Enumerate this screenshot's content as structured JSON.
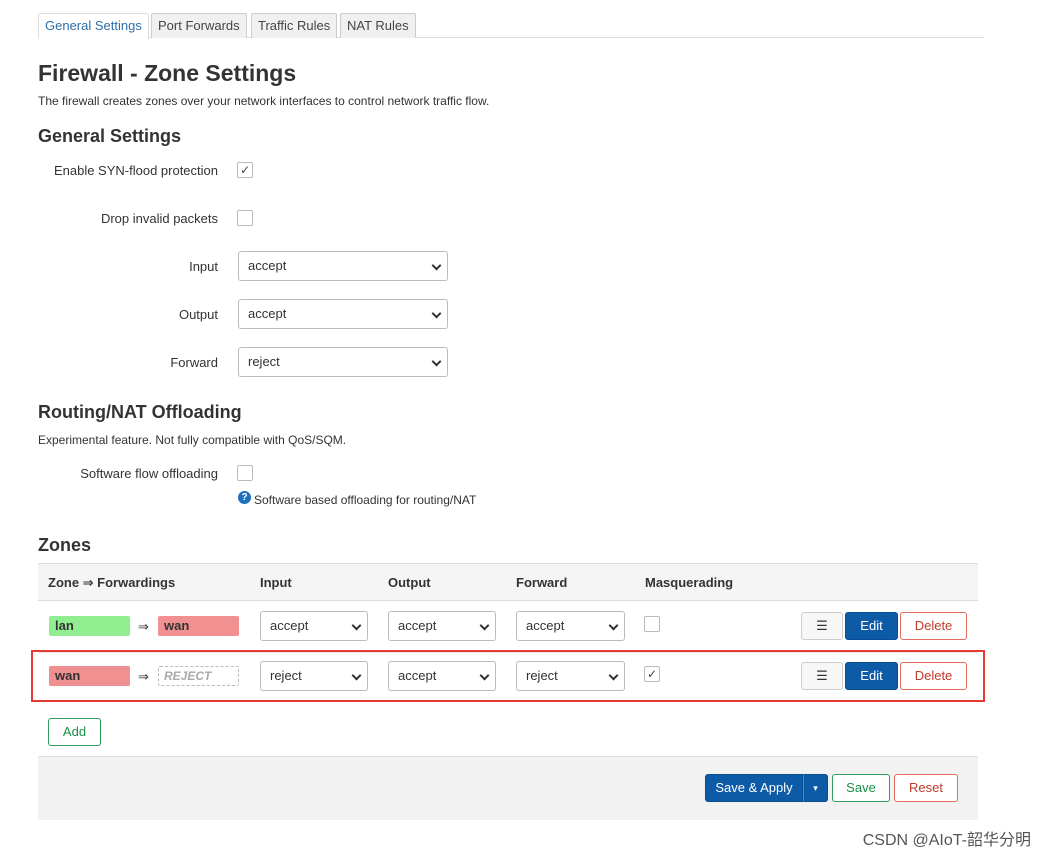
{
  "tabs": [
    {
      "label": "General Settings",
      "active": true
    },
    {
      "label": "Port Forwards"
    },
    {
      "label": "Traffic Rules"
    },
    {
      "label": "NAT Rules"
    }
  ],
  "page": {
    "title": "Firewall - Zone Settings",
    "description": "The firewall creates zones over your network interfaces to control network traffic flow."
  },
  "general": {
    "heading": "General Settings",
    "syn_flood_label": "Enable SYN-flood protection",
    "syn_flood_checked": true,
    "drop_invalid_label": "Drop invalid packets",
    "drop_invalid_checked": false,
    "input_label": "Input",
    "input_value": "accept",
    "output_label": "Output",
    "output_value": "accept",
    "forward_label": "Forward",
    "forward_value": "reject"
  },
  "offloading": {
    "heading": "Routing/NAT Offloading",
    "description": "Experimental feature. Not fully compatible with QoS/SQM.",
    "sw_offload_label": "Software flow offloading",
    "sw_offload_checked": false,
    "help_text": "Software based offloading for routing/NAT"
  },
  "zones": {
    "heading": "Zones",
    "columns": {
      "zone": "Zone ⇒ Forwardings",
      "input": "Input",
      "output": "Output",
      "forward": "Forward",
      "masq": "Masquerading"
    },
    "rows": [
      {
        "name": "lan",
        "name_color": "#90ee90",
        "arrow": "⇒",
        "dest": "wan",
        "dest_color": "#f09090",
        "input": "accept",
        "output": "accept",
        "forward": "accept",
        "masq": false,
        "masq_mark": ""
      },
      {
        "name": "wan",
        "name_color": "#f09090",
        "arrow": "⇒",
        "dest": "REJECT",
        "input": "reject",
        "output": "accept",
        "forward": "reject",
        "masq": true,
        "masq_mark": "✓"
      }
    ],
    "menu_label": "☰",
    "edit_label": "Edit",
    "delete_label": "Delete",
    "add_label": "Add"
  },
  "footer": {
    "save_apply_label": "Save & Apply",
    "apply_dropdown": "▾",
    "save_label": "Save",
    "reset_label": "Reset"
  },
  "watermark": "CSDN @AIoT-韶华分明",
  "icons": {
    "checkmark": "✓",
    "help": "?"
  }
}
